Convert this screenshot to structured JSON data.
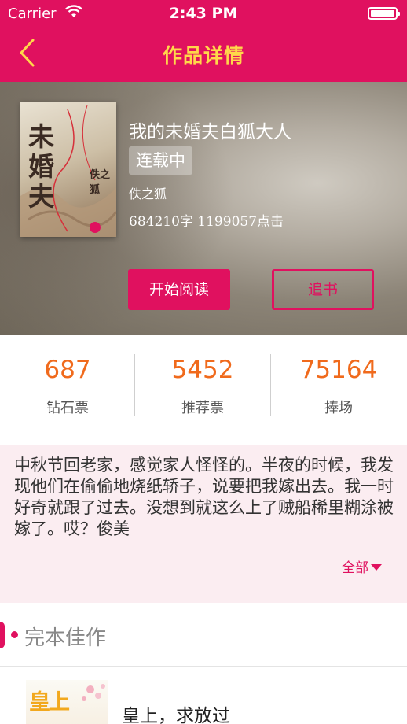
{
  "status_bar": {
    "carrier": "Carrier",
    "time": "2:43 PM"
  },
  "nav": {
    "title": "作品详情",
    "back_icon": "chevron-left-icon"
  },
  "book": {
    "title": "我的未婚夫白狐大人",
    "status": "连载中",
    "author": "佚之狐",
    "stats": "684210字 1199057点击",
    "cover_title_art": "未婚夫",
    "cover_author_art": "佚之狐"
  },
  "actions": {
    "read_label": "开始阅读",
    "follow_label": "追书"
  },
  "tickets": [
    {
      "count": "687",
      "label": "钻石票"
    },
    {
      "count": "5452",
      "label": "推荐票"
    },
    {
      "count": "75164",
      "label": "捧场"
    }
  ],
  "intro": {
    "text": "中秋节回老家，感觉家人怪怪的。半夜的时候，我发现他们在偷偷地烧纸轿子，说要把我嫁出去。我一时好奇就跟了过去。没想到就这么上了贼船稀里糊涂被嫁了。哎？俊美",
    "more_label": "全部"
  },
  "section": {
    "title": "完本佳作"
  },
  "recommend": [
    {
      "title": "皇上，求放过",
      "thumb_art": "皇上"
    }
  ],
  "colors": {
    "brand": "#e0115f",
    "nav_title": "#ffd84a",
    "ticket_number": "#f06a1c",
    "intro_bg": "#fbedf1"
  }
}
